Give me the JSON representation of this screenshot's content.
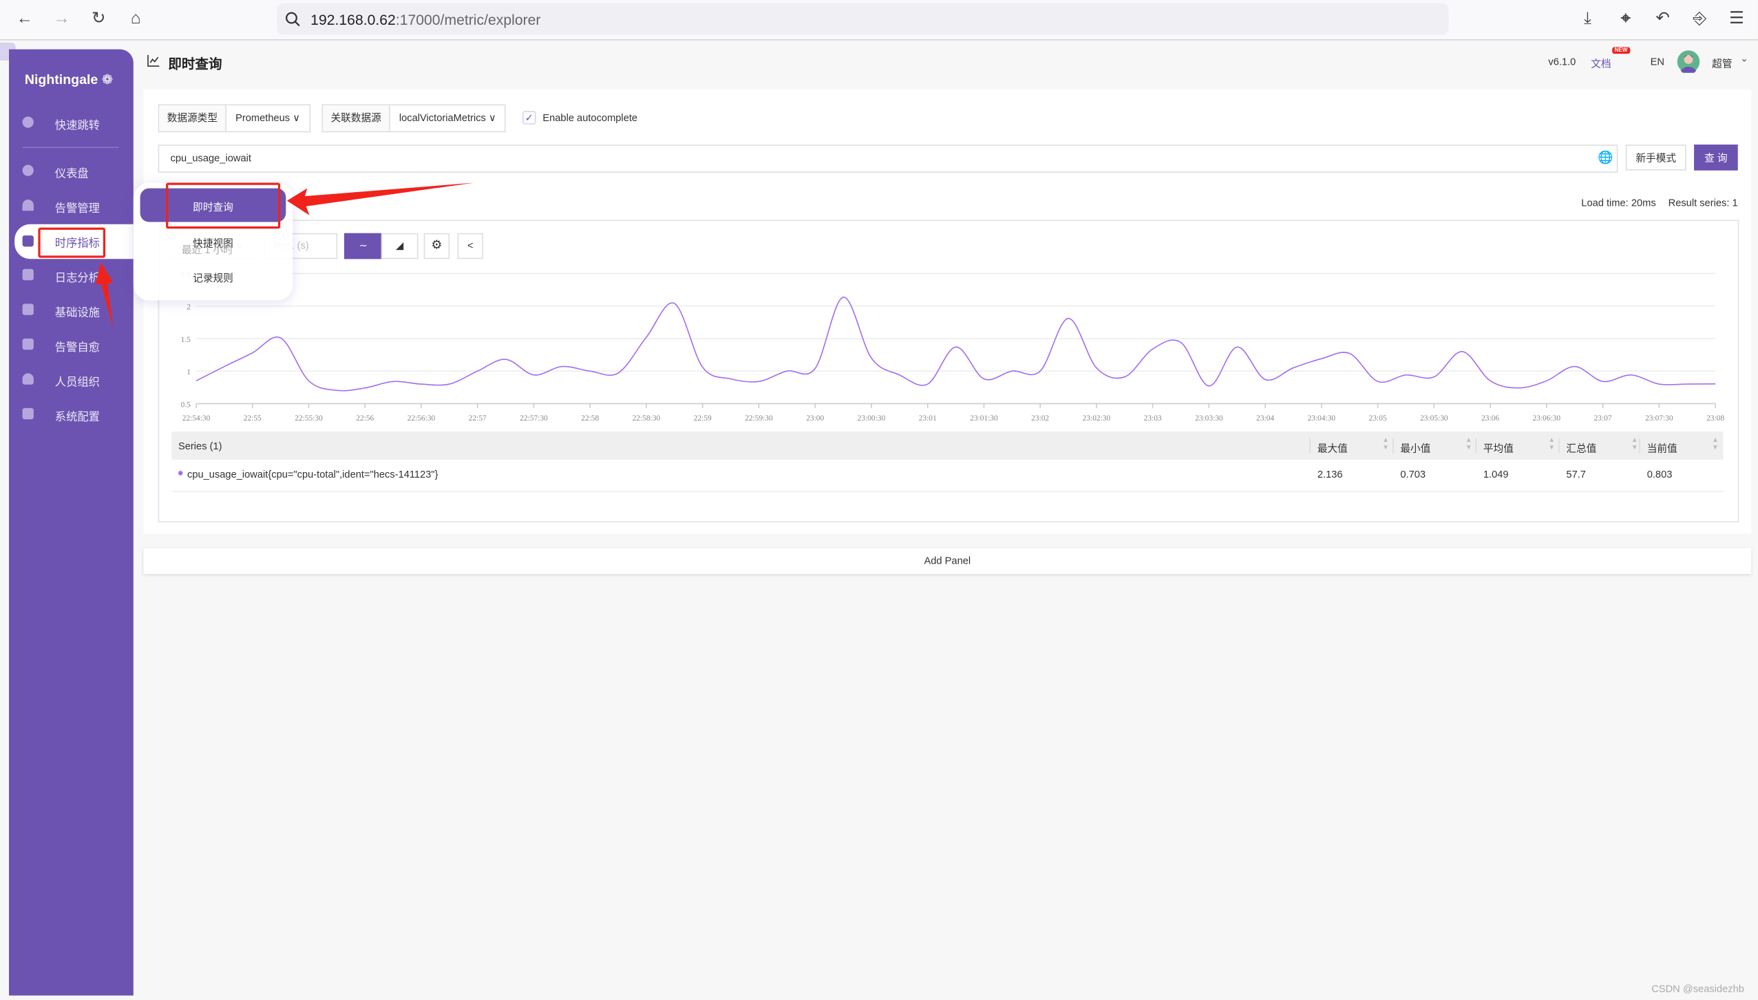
{
  "browser": {
    "url_host": "192.168.0.62",
    "url_path": ":17000/metric/explorer"
  },
  "sidebar": {
    "logo": "Nightingale",
    "items": [
      {
        "label": "快速跳转",
        "icon": "search-icon"
      },
      {
        "label": "仪表盘",
        "icon": "dashboard-icon"
      },
      {
        "label": "告警管理",
        "icon": "alarm-icon"
      },
      {
        "label": "时序指标",
        "icon": "metric-icon",
        "active": true
      },
      {
        "label": "日志分析",
        "icon": "log-icon"
      },
      {
        "label": "基础设施",
        "icon": "server-icon"
      },
      {
        "label": "告警自愈",
        "icon": "terminal-icon"
      },
      {
        "label": "人员组织",
        "icon": "user-icon"
      },
      {
        "label": "系统配置",
        "icon": "grid-icon"
      }
    ]
  },
  "submenu": {
    "items": [
      {
        "label": "即时查询",
        "active": true
      },
      {
        "label": "快捷视图"
      },
      {
        "label": "记录规则"
      }
    ]
  },
  "header": {
    "title": "即时查询",
    "version": "v6.1.0",
    "docs": "文档",
    "new_badge": "NEW",
    "language": "EN",
    "user": "超管"
  },
  "query": {
    "datasource_type_label": "数据源类型",
    "datasource_type": "Prometheus",
    "datasource_label": "关联数据源",
    "datasource": "localVictoriaMetrics",
    "autocomplete_label": "Enable autocomplete",
    "autocomplete_checked": true,
    "expression": "cpu_usage_iowait",
    "novice_mode": "新手模式",
    "query_button": "查 询",
    "load_time": "Load time: 20ms",
    "result_series": "Result series: 1"
  },
  "panel": {
    "time_range": "最近 1 小时",
    "resolution_placeholder": "Res. (s)",
    "view_mode": "line"
  },
  "table": {
    "series_header": "Series (1)",
    "columns": [
      "最大值",
      "最小值",
      "平均值",
      "汇总值",
      "当前值"
    ],
    "rows": [
      {
        "series": "cpu_usage_iowait{cpu=\"cpu-total\",ident=\"hecs-141123\"}",
        "values": [
          "2.136",
          "0.703",
          "1.049",
          "57.7",
          "0.803"
        ]
      }
    ]
  },
  "add_panel": "Add Panel",
  "watermark": "CSDN @seasidezhb",
  "colors": {
    "brand": "#6c53b1",
    "series": "#a26ef0",
    "annotation": "#f0231c"
  },
  "chart_data": {
    "type": "line",
    "ylim": [
      0.5,
      2.5
    ],
    "y_ticks": [
      "0.5",
      "1",
      "1.5",
      "2",
      "2.5"
    ],
    "x_ticks": [
      "22:54:30",
      "22:55",
      "22:55:30",
      "22:56",
      "22:56:30",
      "22:57",
      "22:57:30",
      "22:58",
      "22:58:30",
      "22:59",
      "22:59:30",
      "23:00",
      "23:00:30",
      "23:01",
      "23:01:30",
      "23:02",
      "23:02:30",
      "23:03",
      "23:03:30",
      "23:04",
      "23:04:30",
      "23:05",
      "23:05:30",
      "23:06",
      "23:06:30",
      "23:07",
      "23:07:30",
      "23:08"
    ],
    "grid": true,
    "series": [
      {
        "name": "cpu_usage_iowait{cpu=\"cpu-total\",ident=\"hecs-141123\"}",
        "x": [
          "22:54:30",
          "22:54:45",
          "22:55:00",
          "22:55:15",
          "22:55:30",
          "22:55:45",
          "22:56:00",
          "22:56:15",
          "22:56:30",
          "22:56:45",
          "22:57:00",
          "22:57:15",
          "22:57:30",
          "22:57:45",
          "22:58:00",
          "22:58:15",
          "22:58:30",
          "22:58:45",
          "22:59:00",
          "22:59:15",
          "22:59:30",
          "22:59:45",
          "23:00:00",
          "23:00:15",
          "23:00:30",
          "23:00:45",
          "23:01:00",
          "23:01:15",
          "23:01:30",
          "23:01:45",
          "23:02:00",
          "23:02:15",
          "23:02:30",
          "23:02:45",
          "23:03:00",
          "23:03:15",
          "23:03:30",
          "23:03:45",
          "23:04:00",
          "23:04:15",
          "23:04:30",
          "23:04:45",
          "23:05:00",
          "23:05:15",
          "23:05:30",
          "23:05:45",
          "23:06:00",
          "23:06:15",
          "23:06:30",
          "23:06:45",
          "23:07:00",
          "23:07:15",
          "23:07:30",
          "23:07:45",
          "23:08:00"
        ],
        "values": [
          0.85,
          1.07,
          1.28,
          1.51,
          0.85,
          0.703,
          0.74,
          0.84,
          0.8,
          0.8,
          1.0,
          1.18,
          0.94,
          1.07,
          1.0,
          0.97,
          1.52,
          2.04,
          1.06,
          0.88,
          0.84,
          1.0,
          1.04,
          2.136,
          1.2,
          0.94,
          0.8,
          1.37,
          0.88,
          1.0,
          1.0,
          1.81,
          1.05,
          0.91,
          1.34,
          1.44,
          0.77,
          1.37,
          0.87,
          1.05,
          1.19,
          1.27,
          0.84,
          0.94,
          0.91,
          1.3,
          0.85,
          0.74,
          0.85,
          1.07,
          0.84,
          0.94,
          0.8,
          0.8,
          0.803
        ]
      }
    ]
  }
}
